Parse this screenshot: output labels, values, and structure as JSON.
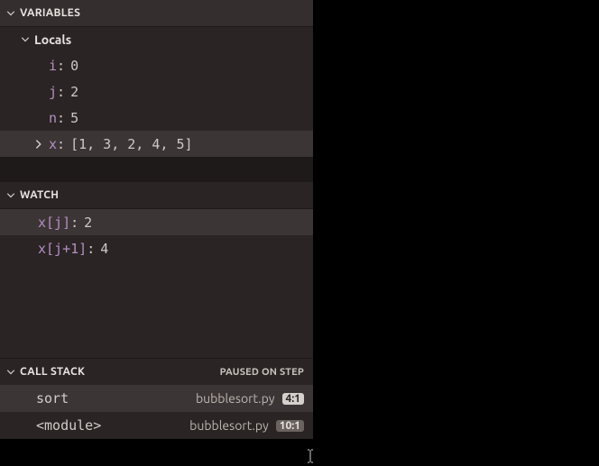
{
  "variables": {
    "title": "VARIABLES",
    "locals": {
      "title": "Locals",
      "items": [
        {
          "name": "i",
          "value": "0"
        },
        {
          "name": "j",
          "value": "2"
        },
        {
          "name": "n",
          "value": "5"
        },
        {
          "name": "x",
          "value": "[1, 3, 2, 4, 5]"
        }
      ]
    }
  },
  "watch": {
    "title": "WATCH",
    "items": [
      {
        "expr": "x[j]",
        "value": "2"
      },
      {
        "expr": "x[j+1]",
        "value": "4"
      }
    ]
  },
  "callstack": {
    "title": "CALL STACK",
    "status": "PAUSED ON STEP",
    "frames": [
      {
        "fn": "sort",
        "file": "bubblesort.py",
        "pos": "4:1"
      },
      {
        "fn": "<module>",
        "file": "bubblesort.py",
        "pos": "10:1"
      }
    ]
  }
}
